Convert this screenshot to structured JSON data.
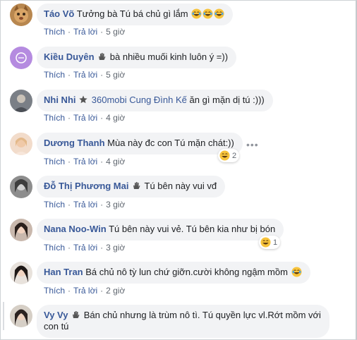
{
  "colors": {
    "name": "#385898",
    "meta": "#606770",
    "bubble": "#f2f3f5",
    "laugh": "#f7c33b"
  },
  "icons": {
    "wave_badge": "waving-hand-icon",
    "star_badge": "star-icon",
    "laugh": "laughing-face-icon"
  },
  "actions": {
    "like": "Thích",
    "reply": "Trả lời",
    "sep": "·"
  },
  "comments": [
    {
      "name": "Táo Võ",
      "text": "Tưởng bà Tú bá chủ gì lắm",
      "time": "5 giờ",
      "emojis": 3
    },
    {
      "name": "Kiều Duyên",
      "text": "bà nhiều muối kinh luôn ý =))",
      "time": "5 giờ"
    },
    {
      "name": "Nhi Nhi",
      "tag": "360mobi Cung Đình Kế",
      "text": "ăn gì mặn dị tú :)))",
      "time": "4 giờ"
    },
    {
      "name": "Dương Thanh",
      "text": "Mùa này đc con Tú mặn chát:))",
      "time": "4 giờ",
      "reaction_count": "2"
    },
    {
      "name": "Đỗ Thị Phương Mai",
      "text": "Tú bên này vui vđ",
      "time": "3 giờ"
    },
    {
      "name": "Nana Noo-Win",
      "text": "Tú bên này vui vẻ. Tú bên kia như bị bón",
      "time": "3 giờ",
      "reaction_count": "1"
    },
    {
      "name": "Han Tran",
      "text": "Bá chủ nô tỳ lun chứ giỡn.cười không ngậm mồm",
      "time": "2 giờ"
    },
    {
      "name": "Vy Vy",
      "text": "Bán chủ nhưng là trùm nô tì. Tú quyền lực vl.Rớt mồm với con tú"
    }
  ]
}
